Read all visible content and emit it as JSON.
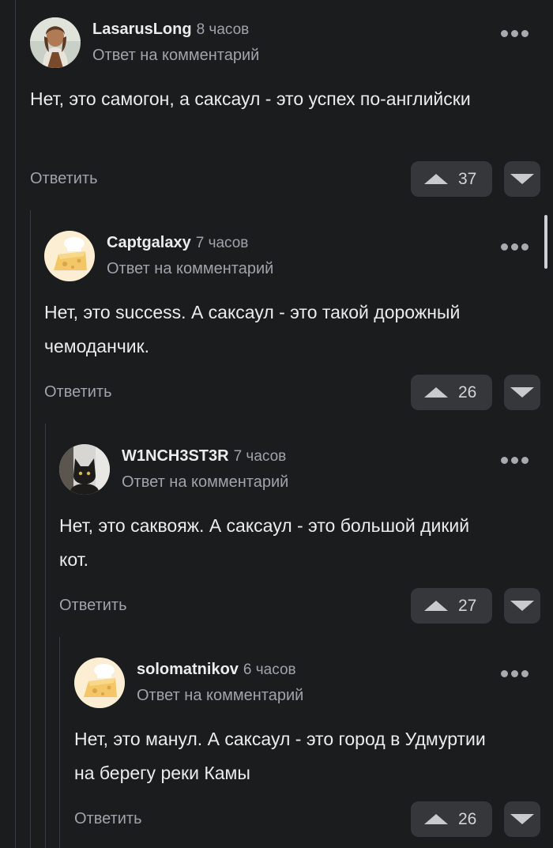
{
  "ui": {
    "reply_label": "Ответить",
    "reply_to_label": "Ответ на комментарий"
  },
  "colors": {
    "background": "#1b1c1e",
    "vote_button": "#36373a",
    "thread_line": "#3a3b3e",
    "muted_text": "#a2a3a7"
  },
  "comments": [
    {
      "author": "LasarusLong",
      "time": "8 часов",
      "reply_to": "Ответ на комментарий",
      "text": "Нет, это самогон, а саксаул - это успех по-английски",
      "rating": "37",
      "avatar_icon": "portrait-avatar-icon"
    },
    {
      "author": "Captgalaxy",
      "time": "7 часов",
      "reply_to": "Ответ на комментарий",
      "text": "Нет, это success. А саксаул - это такой дорожный чемоданчик.",
      "rating": "26",
      "avatar_icon": "chef-cheese-avatar-icon"
    },
    {
      "author": "W1NCH3ST3R",
      "time": "7 часов",
      "reply_to": "Ответ на комментарий",
      "text": "Нет, это саквояж. А саксаул - это большой дикий кот.",
      "rating": "27",
      "avatar_icon": "cat-avatar-icon"
    },
    {
      "author": "solomatnikov",
      "time": "6 часов",
      "reply_to": "Ответ на комментарий",
      "text": "Нет, это манул. А саксаул - это город в Удмуртии на берегу реки Камы",
      "rating": "26",
      "avatar_icon": "chef-cheese-avatar-icon"
    }
  ]
}
